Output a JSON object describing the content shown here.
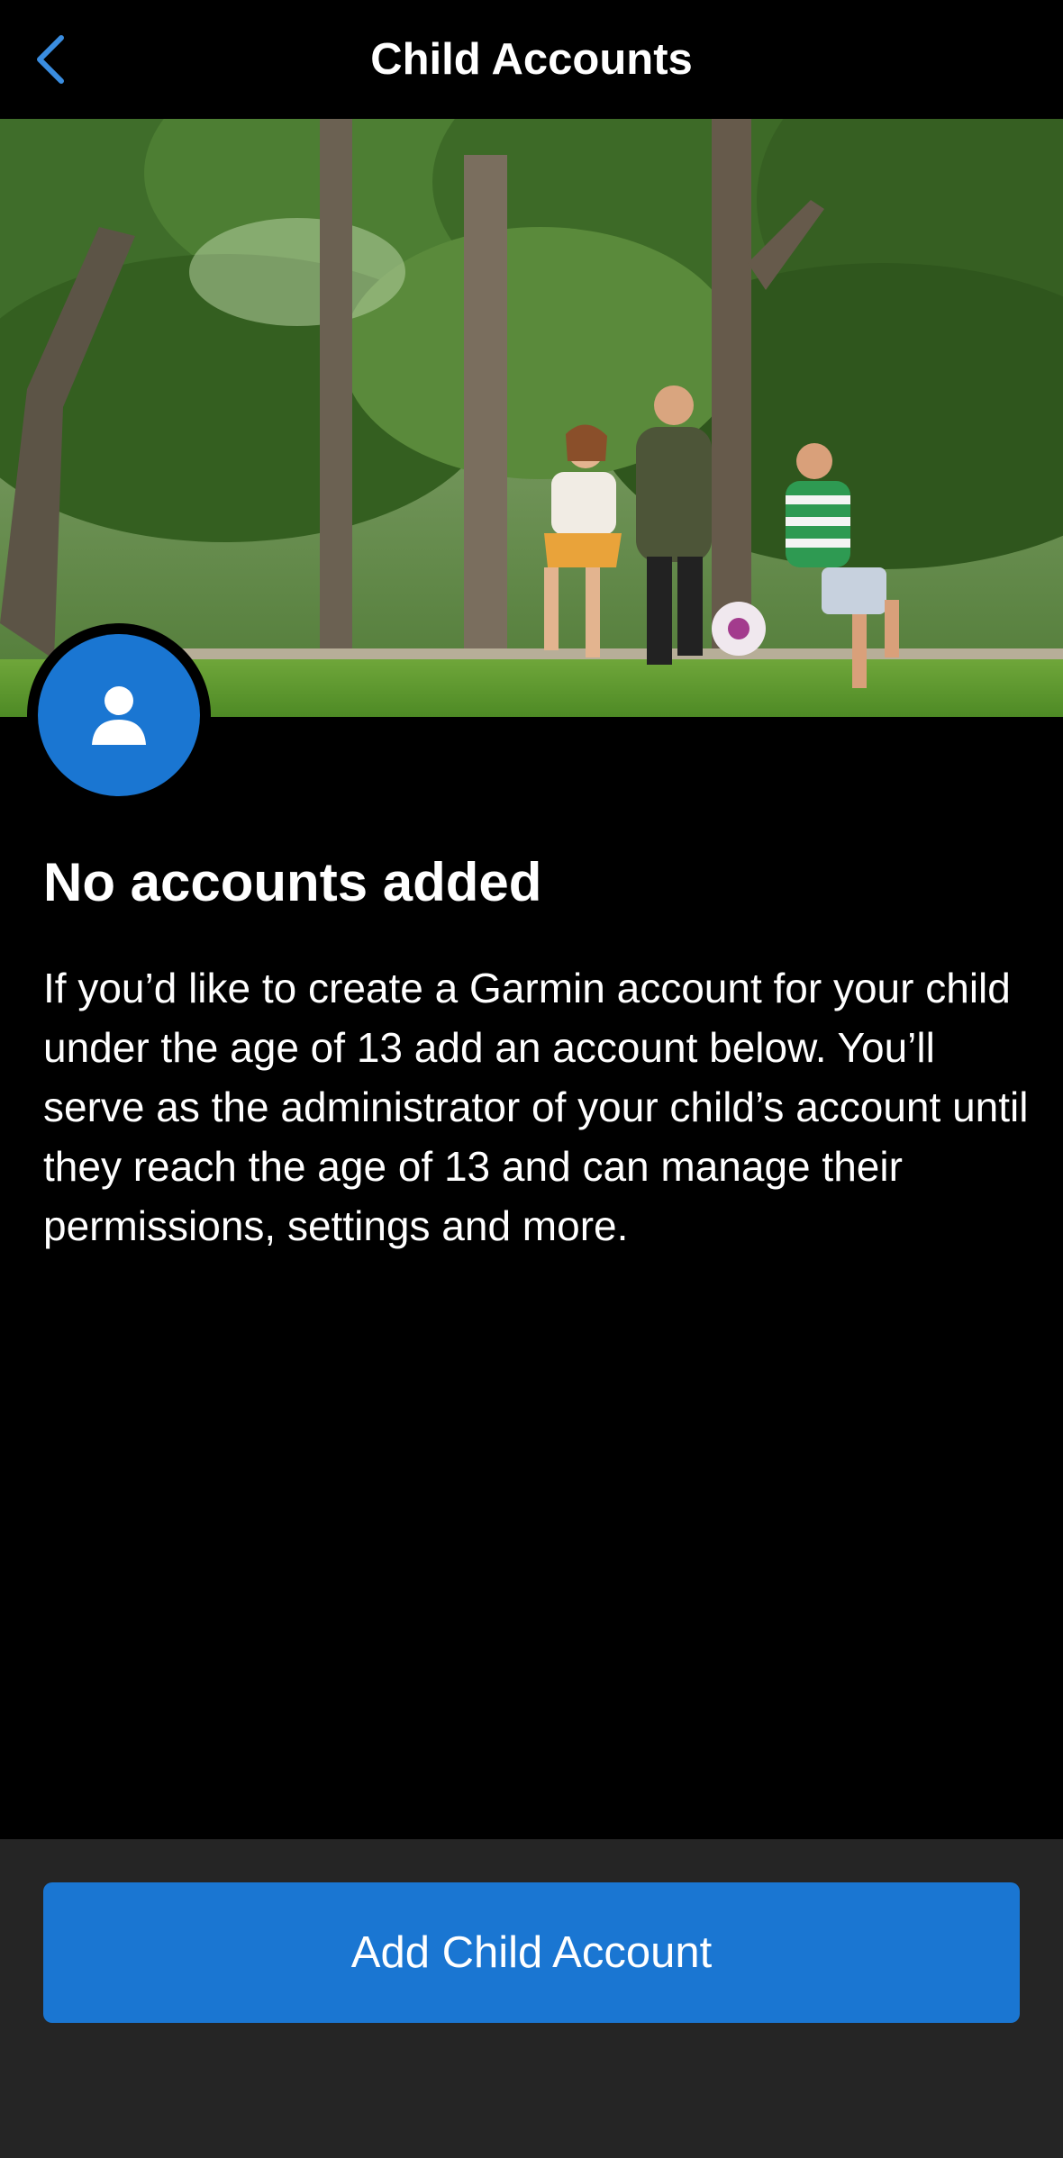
{
  "header": {
    "title": "Child Accounts",
    "back_icon": "chevron-left-icon"
  },
  "hero": {
    "image": "family-playing-soccer-photo"
  },
  "avatar": {
    "icon": "person-icon"
  },
  "empty_state": {
    "title": "No accounts added",
    "description": "If you’d like to create a Garmin account for your child under the age of 13 add an account below. You’ll serve as the administrator of your child’s account until they reach the age of 13 and can manage their permissions, settings and more."
  },
  "footer": {
    "add_button_label": "Add Child Account"
  },
  "colors": {
    "accent": "#1a76d2",
    "back_icon": "#3a8de0",
    "background": "#000000",
    "footer_bg": "#252525"
  }
}
